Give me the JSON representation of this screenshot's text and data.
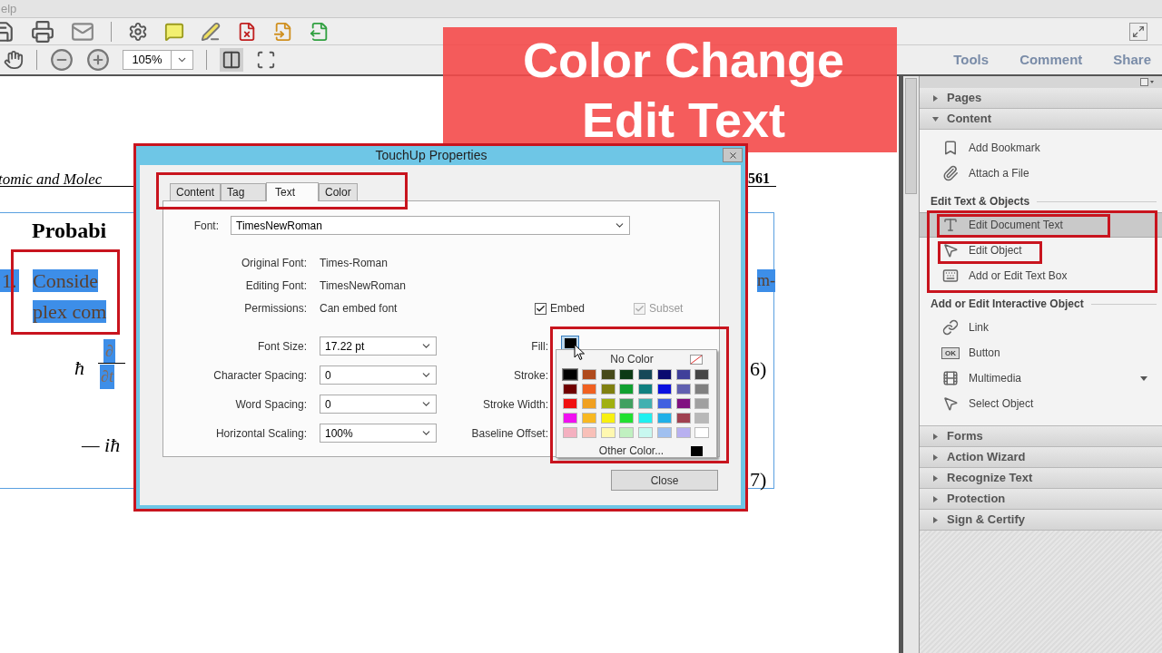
{
  "menu_bar": {
    "text": "elp"
  },
  "toolbar": {
    "zoom": "105%",
    "tabs": [
      {
        "label": "Tools"
      },
      {
        "label": "Comment"
      },
      {
        "label": "Share"
      }
    ]
  },
  "banner": {
    "lines": [
      "Color Change",
      "Edit Text"
    ]
  },
  "document": {
    "header": "tomic and Molec",
    "page_number": "561",
    "heading": "Probabi",
    "selected_text": [
      {
        "text": "1.",
        "selected": true
      },
      {
        "text": "Conside",
        "selected": true
      },
      {
        "text": "m-",
        "selected": true
      },
      {
        "text": "plex com",
        "selected": true
      }
    ],
    "symbol": "ħ",
    "fraction_top": "∂",
    "fraction_bottom": "∂t",
    "equation_6": "6)",
    "expression": "— iħ",
    "equation_7": "7)"
  },
  "dialog": {
    "title": "TouchUp Properties",
    "tabs": [
      {
        "label": "Content",
        "selected": false
      },
      {
        "label": "Tag",
        "selected": false
      },
      {
        "label": "Text",
        "selected": true
      },
      {
        "label": "Color",
        "selected": false
      }
    ],
    "font": {
      "label": "Font:",
      "value": "TimesNewRoman"
    },
    "info": [
      {
        "label": "Original Font:",
        "value": "Times-Roman"
      },
      {
        "label": "Editing Font:",
        "value": "TimesNewRoman"
      },
      {
        "label": "Permissions:",
        "value": "Can embed font"
      }
    ],
    "checkboxes": [
      {
        "label": "Embed",
        "checked": true,
        "disabled": false
      },
      {
        "label": "Subset",
        "checked": true,
        "disabled": true
      }
    ],
    "selects": [
      {
        "label": "Font Size:",
        "value": "17.22 pt"
      },
      {
        "label": "Character Spacing:",
        "value": "0"
      },
      {
        "label": "Word Spacing:",
        "value": "0"
      },
      {
        "label": "Horizontal Scaling:",
        "value": "100%"
      }
    ],
    "right_labels": [
      "Fill:",
      "Stroke:",
      "Stroke Width:",
      "Baseline Offset:"
    ],
    "fill": {
      "color": "#000000",
      "open": true
    },
    "palette": {
      "no_color": "No Color",
      "other": {
        "label": "Other Color...",
        "color": "#000000"
      },
      "swatches": [
        {
          "color": "#000000",
          "selected": true
        },
        {
          "color": "#b04a1c",
          "selected": false
        },
        {
          "color": "#474a1a",
          "selected": false
        },
        {
          "color": "#0c3a16",
          "selected": false
        },
        {
          "color": "#154858",
          "selected": false
        },
        {
          "color": "#0a0a70",
          "selected": false
        },
        {
          "color": "#40409a",
          "selected": false
        },
        {
          "color": "#454545",
          "selected": false
        },
        {
          "color": "#700000",
          "selected": false
        },
        {
          "color": "#f06020",
          "selected": false
        },
        {
          "color": "#808010",
          "selected": false
        },
        {
          "color": "#10a030",
          "selected": false
        },
        {
          "color": "#108080",
          "selected": false
        },
        {
          "color": "#0a10e0",
          "selected": false
        },
        {
          "color": "#6060b0",
          "selected": false
        },
        {
          "color": "#808080",
          "selected": false
        },
        {
          "color": "#f01010",
          "selected": false
        },
        {
          "color": "#f0a020",
          "selected": false
        },
        {
          "color": "#a0b010",
          "selected": false
        },
        {
          "color": "#40a060",
          "selected": false
        },
        {
          "color": "#40b0b0",
          "selected": false
        },
        {
          "color": "#4060e0",
          "selected": false
        },
        {
          "color": "#801080",
          "selected": false
        },
        {
          "color": "#a0a0a0",
          "selected": false
        },
        {
          "color": "#f010f0",
          "selected": false
        },
        {
          "color": "#f8b820",
          "selected": false
        },
        {
          "color": "#f8f010",
          "selected": false
        },
        {
          "color": "#20e030",
          "selected": false
        },
        {
          "color": "#20f0f0",
          "selected": false
        },
        {
          "color": "#20b0e8",
          "selected": false
        },
        {
          "color": "#a04050",
          "selected": false
        },
        {
          "color": "#b8b8b8",
          "selected": false
        },
        {
          "color": "#f4b0c0",
          "selected": false
        },
        {
          "color": "#f8c0b8",
          "selected": false
        },
        {
          "color": "#fff8b0",
          "selected": false
        },
        {
          "color": "#c0f0c0",
          "selected": false
        },
        {
          "color": "#c8f8f0",
          "selected": false
        },
        {
          "color": "#a0c0f0",
          "selected": false
        },
        {
          "color": "#b8b0f0",
          "selected": false
        },
        {
          "color": "#ffffff",
          "selected": false
        }
      ]
    },
    "close": "Close"
  },
  "panel": {
    "sections": [
      {
        "title": "Pages",
        "expanded": false
      },
      {
        "title": "Content",
        "expanded": true,
        "groups": [
          {
            "items": [
              {
                "label": "Add Bookmark",
                "selected": false,
                "dropdown": false
              },
              {
                "label": "Attach a File",
                "selected": false,
                "dropdown": false
              }
            ]
          },
          {
            "title": "Edit Text & Objects",
            "items": [
              {
                "label": "Edit Document Text",
                "selected": true,
                "dropdown": false
              },
              {
                "label": "Edit Object",
                "selected": false,
                "dropdown": false
              },
              {
                "label": "Add or Edit Text Box",
                "selected": false,
                "dropdown": false
              }
            ]
          },
          {
            "title": "Add or Edit Interactive Object",
            "items": [
              {
                "label": "Link",
                "selected": false,
                "dropdown": false
              },
              {
                "label": "Button",
                "selected": false,
                "dropdown": false,
                "icon_text": "OK"
              },
              {
                "label": "Multimedia",
                "selected": false,
                "dropdown": true
              },
              {
                "label": "Select Object",
                "selected": false,
                "dropdown": false
              }
            ]
          }
        ]
      },
      {
        "title": "Forms",
        "expanded": false
      },
      {
        "title": "Action Wizard",
        "expanded": false
      },
      {
        "title": "Recognize Text",
        "expanded": false
      },
      {
        "title": "Protection",
        "expanded": false
      },
      {
        "title": "Sign & Certify",
        "expanded": false
      }
    ]
  }
}
